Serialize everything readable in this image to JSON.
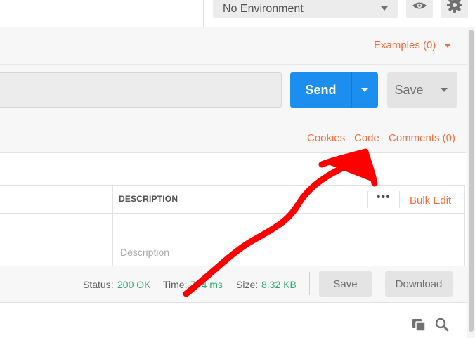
{
  "header": {
    "environment": "No Environment",
    "environment_icon": "caret-down",
    "eye_icon": "eye-icon",
    "gear_icon": "gear-icon"
  },
  "tabs": {
    "examples_label": "Examples (0)"
  },
  "request": {
    "send_label": "Send",
    "save_label": "Save"
  },
  "subtabs": {
    "cookies": "Cookies",
    "code": "Code",
    "comments": "Comments (0)"
  },
  "params_table": {
    "columns": [
      "DESCRIPTION"
    ],
    "more_label": "•••",
    "bulk_edit": "Bulk Edit",
    "description_placeholder": "Description"
  },
  "response": {
    "status_label": "Status:",
    "status_value": "200 OK",
    "time_label": "Time:",
    "time_value": "7_4 ms",
    "size_label": "Size:",
    "size_value": "8.32 KB",
    "save_label": "Save",
    "download_label": "Download"
  },
  "colors": {
    "accent_orange": "#f26b3a",
    "send_blue": "#1c8ef0",
    "status_green": "#2eac6d",
    "annotation_red": "#ff0000"
  }
}
